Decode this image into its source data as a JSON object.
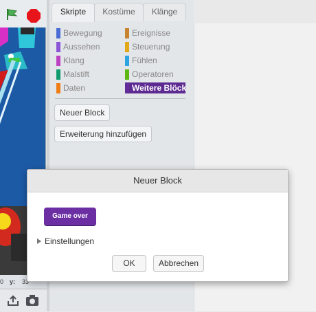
{
  "stage": {
    "x_value": "0",
    "y_label": "y:",
    "y_value": "33"
  },
  "tabs": [
    {
      "label": "Skripte"
    },
    {
      "label": "Kostüme"
    },
    {
      "label": "Klänge"
    }
  ],
  "categories": [
    {
      "label": "Bewegung",
      "color": "#4a6cd4"
    },
    {
      "label": "Ereignisse",
      "color": "#c88330"
    },
    {
      "label": "Aussehen",
      "color": "#8a55d7"
    },
    {
      "label": "Steuerung",
      "color": "#e1a91a"
    },
    {
      "label": "Klang",
      "color": "#bb42c3"
    },
    {
      "label": "Fühlen",
      "color": "#2ca5e2"
    },
    {
      "label": "Malstift",
      "color": "#0e9a6c"
    },
    {
      "label": "Operatoren",
      "color": "#5cb712"
    },
    {
      "label": "Daten",
      "color": "#ee7d16"
    },
    {
      "label": "Weitere Blöcke",
      "color": "#632d99"
    }
  ],
  "palette": {
    "new_block_button": "Neuer Block",
    "add_extension_button": "Erweiterung hinzufügen"
  },
  "dialog": {
    "title": "Neuer Block",
    "block_label": "Game over",
    "options_label": "Einstellungen",
    "ok_button": "OK",
    "cancel_button": "Abbrechen"
  }
}
